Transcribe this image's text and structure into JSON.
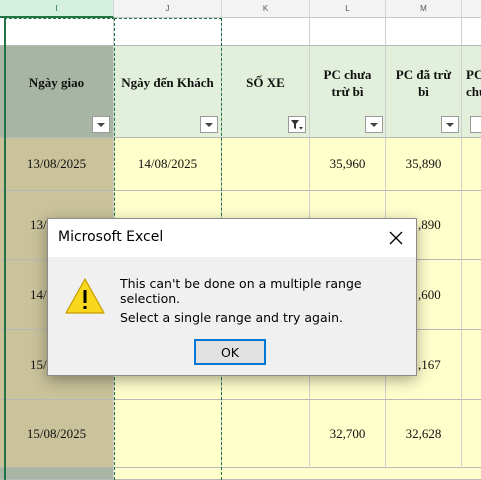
{
  "columns": [
    "I",
    "J",
    "K",
    "L",
    "M"
  ],
  "headers": {
    "ngay_giao": "Ngày giao",
    "ngay_den": "Ngày đến Khách",
    "so_xe": "SỐ XE",
    "pc_chua_1": "PC chưa",
    "pc_chua_2": "trừ bì",
    "pc_da_1": "PC  đã trừ",
    "pc_da_2": "bì",
    "pc_next_1": "PC",
    "pc_next_2": "chư"
  },
  "rows": [
    {
      "ngay_giao": "13/08/2025",
      "ngay_den": "14/08/2025",
      "pc_chua": "35,960",
      "pc_da": "35,890"
    },
    {
      "ngay_giao": "13/",
      "pc_da": ",890"
    },
    {
      "ngay_giao": "14/",
      "pc_da": ",600"
    },
    {
      "ngay_giao": "15/",
      "pc_da": ",167"
    },
    {
      "ngay_giao": "15/08/2025",
      "pc_chua": "32,700",
      "pc_da": "32,628"
    }
  ],
  "dialog": {
    "title": "Microsoft Excel",
    "message1": "This can't be done on a multiple range selection.",
    "message2": "Select a single range and try again.",
    "ok_label": "OK"
  },
  "colors": {
    "header_green": "#e2efda",
    "header_gray": "#a9b5a4",
    "data_yellow": "#ffffcc",
    "data_khaki": "#c9c29b",
    "selection_green": "#217346",
    "warning_yellow": "#f9d71c"
  }
}
